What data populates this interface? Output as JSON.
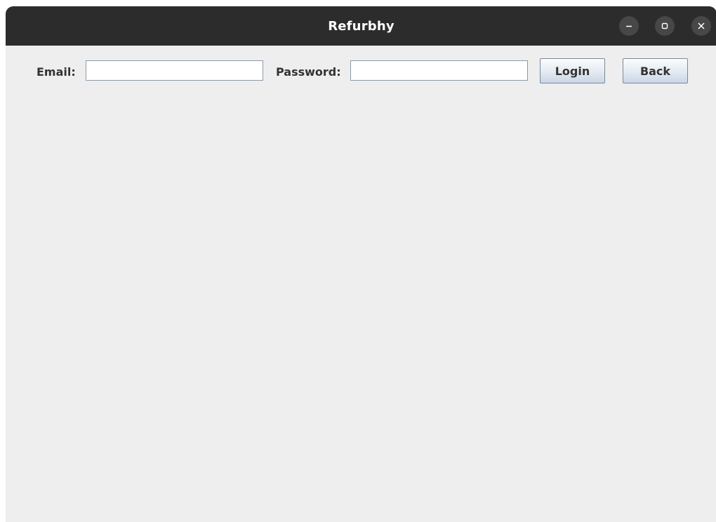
{
  "window": {
    "title": "Refurbhy"
  },
  "window_controls": {
    "minimize_icon": "minimize-icon",
    "maximize_icon": "maximize-icon",
    "close_icon": "close-icon"
  },
  "form": {
    "email_label": "Email:",
    "email_value": "",
    "password_label": "Password:",
    "password_value": "",
    "login_label": "Login",
    "back_label": "Back"
  },
  "colors": {
    "titlebar": "#2c2c2c",
    "background": "#eeeeee"
  }
}
